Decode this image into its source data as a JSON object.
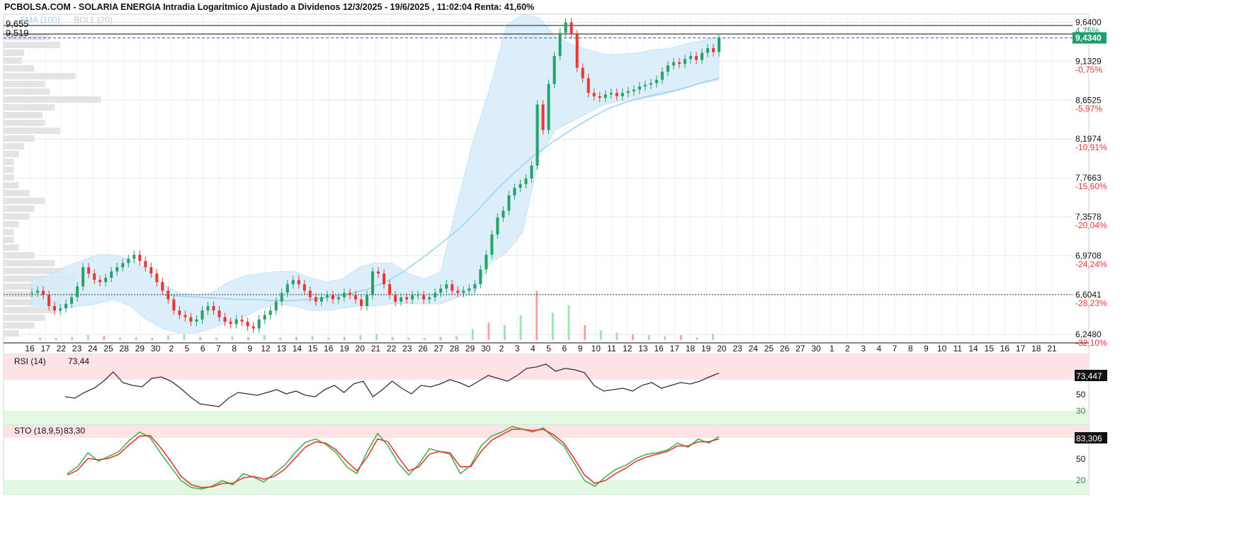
{
  "header": {
    "title": "PCBOLSA.COM - SOLARIA ENERGIA Intradia Logaritmico Ajustado a Dividenos 12/3/2025 - 19/6/2025 , 11:02:04 Renta: 41,60%",
    "legend_left": "SMA (100)",
    "legend_right": "BOLL (20)",
    "level_high": "9,655",
    "level_low": "9,519"
  },
  "price_axis": {
    "ticks": [
      "9,6400",
      "9,1329",
      "8,6525",
      "8,1974",
      "7,7663",
      "7,3578",
      "6,9708",
      "6,6041",
      "6,2480"
    ],
    "pcts": [
      "4,75%",
      "-0,75%",
      "-5,97%",
      "-10,91%",
      "-15,60%",
      "-20,04%",
      "-24,24%",
      "-28,23%",
      "-32,10%"
    ],
    "current_price_label": "9,4340"
  },
  "date_axis": {
    "labels": [
      "16",
      "17",
      "22",
      "23",
      "24",
      "25",
      "28",
      "29",
      "30",
      "2",
      "5",
      "6",
      "7",
      "8",
      "9",
      "12",
      "13",
      "14",
      "15",
      "16",
      "19",
      "20",
      "21",
      "22",
      "23",
      "26",
      "27",
      "28",
      "29",
      "30",
      "2",
      "3",
      "4",
      "5",
      "6",
      "9",
      "10",
      "11",
      "12",
      "13",
      "16",
      "17",
      "18",
      "19",
      "20",
      "23",
      "24",
      "25",
      "26",
      "27",
      "30",
      "1",
      "2",
      "3",
      "4",
      "7",
      "8",
      "9",
      "10",
      "11",
      "14",
      "15",
      "16",
      "17",
      "18",
      "21"
    ]
  },
  "rsi": {
    "label": "RSI (14)",
    "value": "73,44",
    "current_label": "73,447",
    "levels": [
      "50",
      "30"
    ]
  },
  "sto": {
    "label": "STO (18,9,5)",
    "value": "83,30",
    "current_label": "83,306",
    "levels": [
      "50",
      "20"
    ]
  },
  "colors": {
    "up": "#26a269",
    "down": "#e53935",
    "bollinger_fill": "#d6ecfa",
    "sma": "#9fd3f2",
    "current_price": "#1f9d6b",
    "rsi_line": "#333333",
    "sto_k": "#4caf50",
    "sto_d": "#e53935",
    "overbought_band": "#fde3e3",
    "oversold_band": "#e3f8e3"
  },
  "chart_data": {
    "type": "line",
    "title": "SOLARIA ENERGIA Intradia Logaritmico",
    "x_start": "16",
    "x_end": "19",
    "y_scale": "log",
    "ylim": [
      6.2,
      9.75
    ],
    "reference_lines": {
      "high": 9.64,
      "previous_high": 9.519,
      "current": 9.434,
      "dotted": 6.6041
    },
    "series": [
      {
        "name": "SOLARIA ENERGIA",
        "values": [
          6.62,
          6.64,
          6.6,
          6.5,
          6.46,
          6.48,
          6.52,
          6.58,
          6.68,
          6.86,
          6.8,
          6.74,
          6.72,
          6.76,
          6.82,
          6.86,
          6.9,
          6.94,
          6.98,
          6.92,
          6.86,
          6.8,
          6.72,
          6.64,
          6.56,
          6.46,
          6.42,
          6.4,
          6.36,
          6.38,
          6.46,
          6.5,
          6.46,
          6.4,
          6.36,
          6.34,
          6.38,
          6.36,
          6.32,
          6.3,
          6.38,
          6.42,
          6.46,
          6.54,
          6.62,
          6.7,
          6.74,
          6.7,
          6.64,
          6.58,
          6.54,
          6.58,
          6.6,
          6.56,
          6.58,
          6.62,
          6.6,
          6.56,
          6.5,
          6.6,
          6.82,
          6.8,
          6.7,
          6.6,
          6.54,
          6.58,
          6.56,
          6.6,
          6.6,
          6.56,
          6.58,
          6.62,
          6.66,
          6.7,
          6.64,
          6.62,
          6.64,
          6.66,
          6.7,
          6.84,
          6.98,
          7.18,
          7.35,
          7.42,
          7.58,
          7.66,
          7.7,
          7.76,
          7.9,
          8.6,
          8.3,
          8.85,
          9.2,
          9.5,
          9.64,
          9.48,
          9.05,
          8.92,
          8.74,
          8.7,
          8.68,
          8.72,
          8.74,
          8.7,
          8.74,
          8.76,
          8.78,
          8.82,
          8.84,
          8.86,
          8.9,
          9.0,
          9.08,
          9.12,
          9.1,
          9.16,
          9.2,
          9.15,
          9.24,
          9.3,
          9.25,
          9.434
        ]
      }
    ],
    "sma100": [
      6.6,
      6.59,
      6.58,
      6.57,
      6.56,
      6.56,
      6.55,
      6.55,
      6.56,
      6.58,
      6.61,
      6.65,
      6.72,
      6.82,
      6.95,
      7.09,
      7.24,
      7.43,
      7.64,
      7.83,
      8.01,
      8.16,
      8.3,
      8.43,
      8.55,
      8.63,
      8.69,
      8.74,
      8.79,
      8.86,
      8.92
    ],
    "bollinger_upper": [
      6.74,
      6.78,
      6.86,
      6.92,
      6.98,
      6.98,
      6.94,
      6.84,
      6.7,
      6.62,
      6.6,
      6.62,
      6.72,
      6.78,
      6.8,
      6.82,
      6.82,
      6.76,
      6.72,
      6.75,
      6.86,
      6.9,
      6.9,
      6.8,
      6.75,
      6.82,
      7.5,
      8.2,
      8.8,
      9.6,
      9.75,
      9.7,
      9.45,
      9.35,
      9.28,
      9.22,
      9.22,
      9.24,
      9.28,
      9.3,
      9.36,
      9.4,
      9.45
    ],
    "bollinger_lower": [
      6.5,
      6.5,
      6.48,
      6.5,
      6.52,
      6.56,
      6.5,
      6.38,
      6.3,
      6.26,
      6.26,
      6.3,
      6.36,
      6.4,
      6.48,
      6.52,
      6.5,
      6.46,
      6.46,
      6.48,
      6.5,
      6.5,
      6.52,
      6.52,
      6.52,
      6.52,
      6.58,
      6.6,
      6.9,
      7.0,
      7.2,
      8.0,
      8.3,
      8.4,
      8.5,
      8.6,
      8.64,
      8.66,
      8.7,
      8.74,
      8.8,
      8.86,
      8.9
    ],
    "volume": [
      0.05,
      0.04,
      0.06,
      0.1,
      0.08,
      0.05,
      0.06,
      0.04,
      0.09,
      0.12,
      0.06,
      0.05,
      0.07,
      0.06,
      0.1,
      0.05,
      0.06,
      0.08,
      0.05,
      0.06,
      0.1,
      0.12,
      0.06,
      0.05,
      0.04,
      0.06,
      0.08,
      0.22,
      0.35,
      0.3,
      0.5,
      1.0,
      0.55,
      0.7,
      0.3,
      0.2,
      0.15,
      0.12,
      0.1,
      0.08,
      0.1,
      0.06,
      0.12
    ],
    "rsi": [
      40,
      38,
      46,
      52,
      62,
      75,
      60,
      56,
      54,
      66,
      68,
      62,
      52,
      40,
      30,
      28,
      26,
      38,
      46,
      44,
      42,
      46,
      50,
      44,
      48,
      42,
      40,
      50,
      56,
      46,
      58,
      62,
      40,
      50,
      62,
      52,
      44,
      56,
      54,
      58,
      64,
      60,
      54,
      62,
      70,
      66,
      62,
      70,
      80,
      82,
      86,
      76,
      80,
      78,
      74,
      56,
      48,
      50,
      52,
      48,
      56,
      60,
      52,
      56,
      60,
      58,
      62,
      68,
      73.4
    ],
    "sto_k": [
      30,
      40,
      60,
      48,
      55,
      62,
      78,
      90,
      82,
      60,
      40,
      20,
      10,
      8,
      12,
      20,
      14,
      30,
      25,
      18,
      30,
      42,
      60,
      75,
      80,
      72,
      60,
      40,
      30,
      62,
      88,
      70,
      45,
      28,
      44,
      66,
      62,
      58,
      30,
      42,
      70,
      84,
      90,
      98,
      94,
      90,
      96,
      82,
      70,
      45,
      20,
      12,
      25,
      36,
      42,
      52,
      58,
      60,
      64,
      74,
      68,
      80,
      74,
      83.3
    ],
    "sto_d": [
      28,
      35,
      52,
      50,
      52,
      58,
      72,
      84,
      85,
      68,
      48,
      26,
      14,
      10,
      11,
      16,
      16,
      24,
      26,
      22,
      26,
      36,
      52,
      68,
      76,
      74,
      64,
      48,
      34,
      54,
      80,
      76,
      54,
      34,
      40,
      58,
      62,
      60,
      40,
      40,
      62,
      78,
      86,
      94,
      94,
      92,
      94,
      86,
      74,
      52,
      28,
      16,
      20,
      30,
      38,
      48,
      54,
      58,
      62,
      70,
      70,
      76,
      76,
      80
    ]
  }
}
